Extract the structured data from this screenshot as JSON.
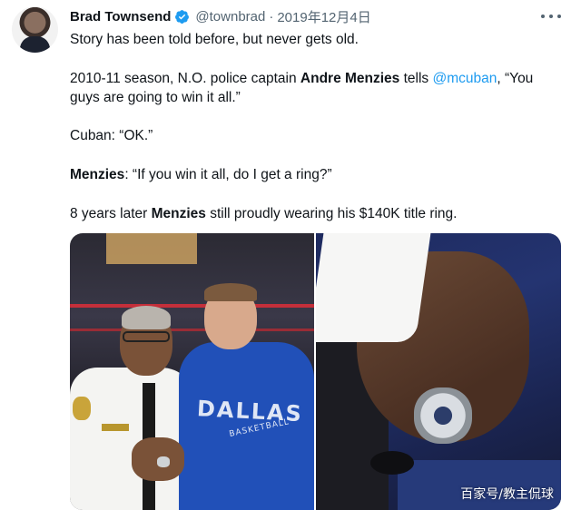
{
  "author": {
    "name": "Brad Townsend",
    "handle": "@townbrad",
    "separator": "·",
    "date": "2019年12月4日",
    "verified_icon": "verified-badge-icon",
    "accent": "#1d9bf0"
  },
  "tweet": {
    "line1": "Story has been told before, but never gets old.",
    "p2_pre": "2010-11 season, N.O. police captain ",
    "p2_bold": "Andre Menzies",
    "p2_mid": " tells ",
    "p2_mention": "@mcuban",
    "p2_post": ", “You guys are going to win it all.”",
    "p3": "Cuban: “OK.”",
    "p4_bold": "Menzies",
    "p4_post": ": “If you win it all, do I get a ring?”",
    "p5_pre": "8 years later ",
    "p5_bold": "Menzies",
    "p5_post": " still proudly wearing his $140K title ring."
  },
  "media": {
    "left_photo": {
      "hoodie_text": "DALLAS",
      "hoodie_sub": "BASKETBALL"
    },
    "right_photo": {
      "watermark": "百家号/教主侃球"
    }
  }
}
